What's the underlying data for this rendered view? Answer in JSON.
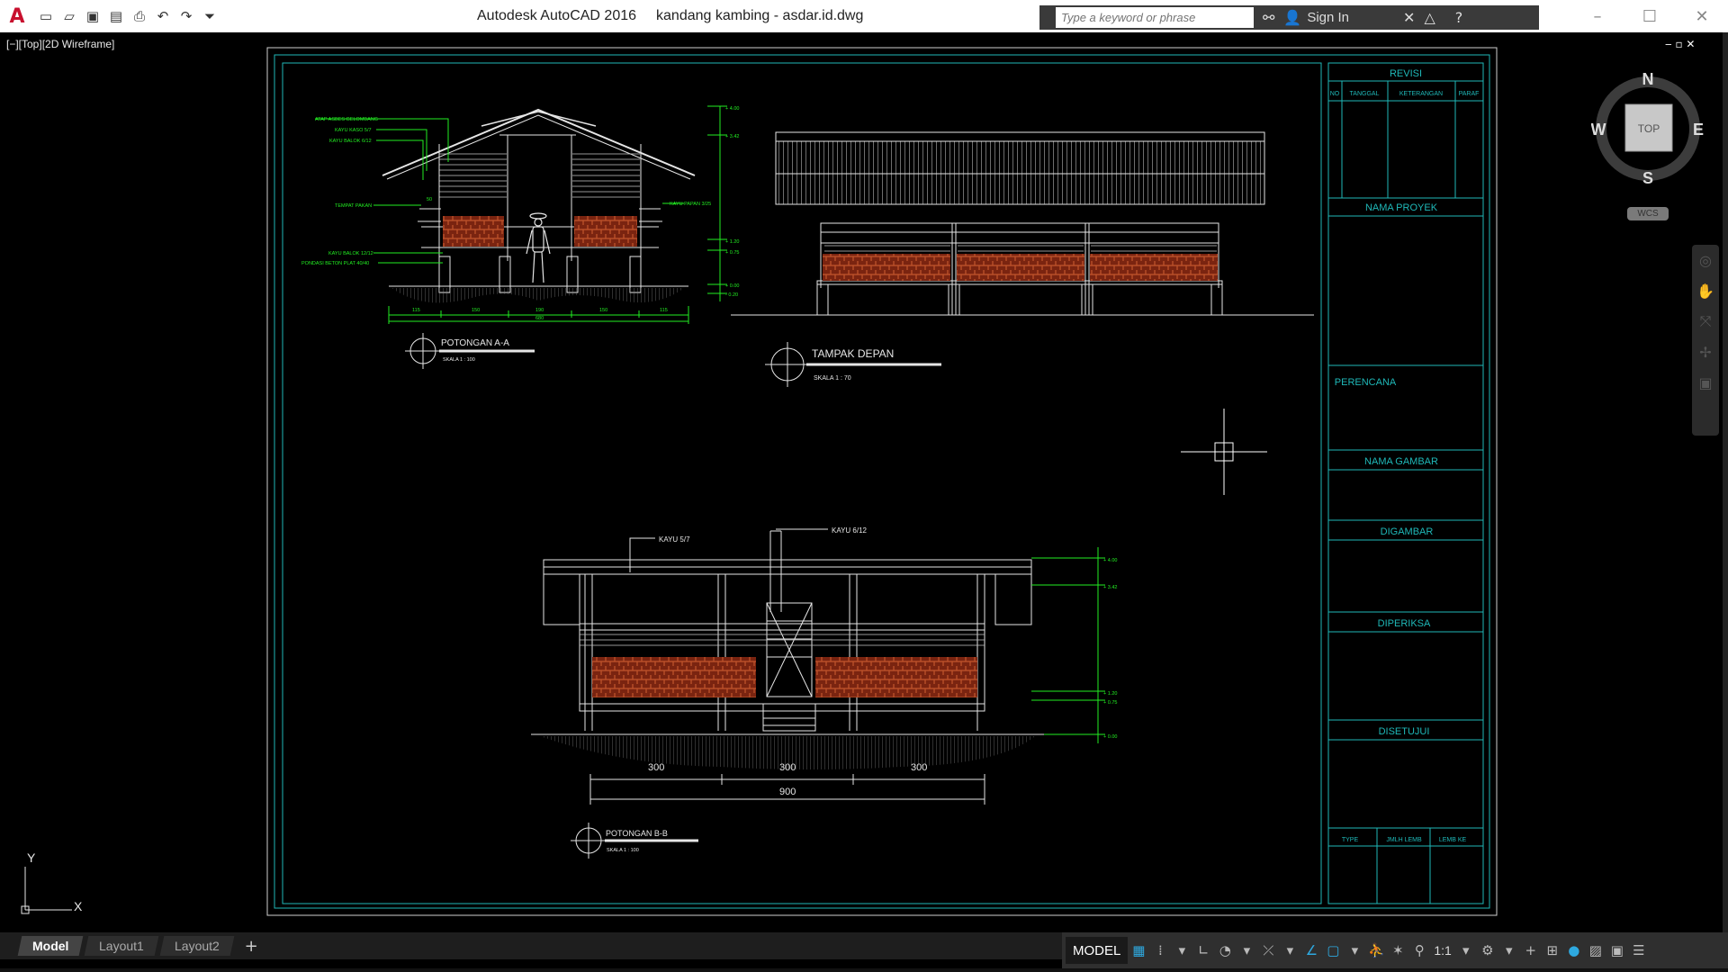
{
  "window": {
    "app_title": "Autodesk AutoCAD 2016",
    "file_title": "kandang kambing - asdar.id.dwg"
  },
  "search": {
    "placeholder": "Type a keyword or phrase"
  },
  "account": {
    "sign_in_label": "Sign In"
  },
  "viewport": {
    "label": "[−][Top][2D Wireframe]"
  },
  "ucs": {
    "y_label": "Y",
    "x_label": "X"
  },
  "navcube": {
    "north": "N",
    "south": "S",
    "east": "E",
    "west": "W",
    "face": "TOP",
    "wcs_label": "WCS"
  },
  "title_block": {
    "revisi": "REVISI",
    "columns": [
      "NO",
      "TANGGAL",
      "KETERANGAN",
      "PARAF"
    ],
    "nama_proyek": "NAMA PROYEK",
    "perencana": "PERENCANA",
    "nama_gambar": "NAMA GAMBAR",
    "digambar": "DIGAMBAR",
    "diperiksa": "DIPERIKSA",
    "disetujui": "DISETUJUI",
    "footer": [
      "TYPE",
      "JMLH LEMB",
      "LEMB KE"
    ]
  },
  "views": {
    "section_aa": {
      "title": "POTONGAN A-A",
      "scale": "SKALA 1 : 100",
      "labels": [
        "ATAP ASBES GELOMBANG",
        "KAYU KASO 5/7",
        "KAYU BALOK 6/12",
        "TEMPAT PAKAN",
        "KAYU BALOK 12/12",
        "PONDASI BETON PLAT 40/40",
        "KAYU PAPAN 3/25",
        "50"
      ],
      "elevations": [
        "+ 4.00",
        "+ 3.42",
        "+ 1.20",
        "+ 0.75",
        "+ 0.00",
        "- 0.20"
      ],
      "dimensions": [
        "115",
        "150",
        "190",
        "150",
        "115",
        "680"
      ]
    },
    "front_view": {
      "title": "TAMPAK DEPAN",
      "scale": "SKALA 1 : 70"
    },
    "section_bb": {
      "title": "POTONGAN B-B",
      "scale": "SKALA 1 : 100",
      "labels": [
        "KAYU 5/7",
        "KAYU 6/12"
      ],
      "elevations": [
        "+ 4.00",
        "+ 3.42",
        "+ 1.20",
        "+ 0.75",
        "+ 0.00"
      ],
      "dimensions": [
        "300",
        "300",
        "300",
        "900"
      ]
    }
  },
  "tabs": [
    {
      "label": "Model",
      "active": true
    },
    {
      "label": "Layout1",
      "active": false
    },
    {
      "label": "Layout2",
      "active": false
    }
  ],
  "status": {
    "space": "MODEL",
    "scale": "1:1"
  },
  "colors": {
    "cyan": "#1fb8b8",
    "green": "#22ee22",
    "brick": "#8a2b12",
    "white": "#e6e6e6",
    "accent": "#2ea9e0"
  }
}
